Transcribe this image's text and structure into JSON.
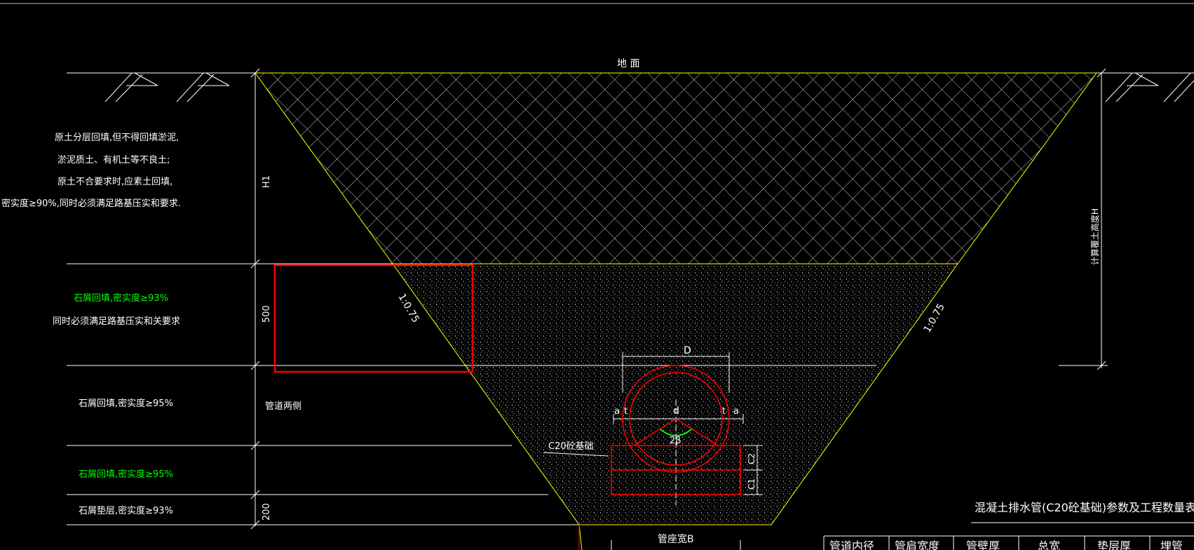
{
  "diagram": {
    "ground_label": "地 面",
    "notes_top": [
      "原土分层回填,但不得回填淤泥,",
      "淤泥质土、有机土等不良土;",
      "原土不合要求时,应素土回填,",
      "密实度≥90%,同时必须满足路基压实和要求."
    ],
    "note_layer1": [
      "石屑回填,密实度≥93%",
      "同时必须满足路基压实和关要求"
    ],
    "note_layer2": "石屑回填,密实度≥95%",
    "note_layer3": "石屑回填,密实度≥95%",
    "note_layer4": "石屑垫层,密实度≥93%",
    "dim_H1": "H1",
    "dim_500": "500",
    "dim_200": "200",
    "pipe_side_label": "管道两侧",
    "slope_left": "1:0.75",
    "slope_right": "1:0.75",
    "dim_D": "D",
    "dim_d": "d",
    "dim_t_left": "t",
    "dim_t_right": "t",
    "dim_a_left": "a",
    "dim_a_right": "a",
    "dim_2beta": "2β",
    "dim_C1": "C1",
    "dim_C2": "C2",
    "base_label": "C20砼基础",
    "right_dim_label": "计算覆土高度H",
    "bottom_width_label": "管座宽B",
    "table_title": "混凝土排水管(C20砼基础)参数及工程数量表",
    "table_headers": [
      "管道内径",
      "管肩宽度",
      "管壁厚",
      "总宽",
      "垫层厚",
      "埋管"
    ]
  },
  "colors": {
    "background": "#000000",
    "yellow_line": "#ffff00",
    "red_line": "#ff0000",
    "green_text": "#00ff00",
    "white": "#ffffff"
  }
}
